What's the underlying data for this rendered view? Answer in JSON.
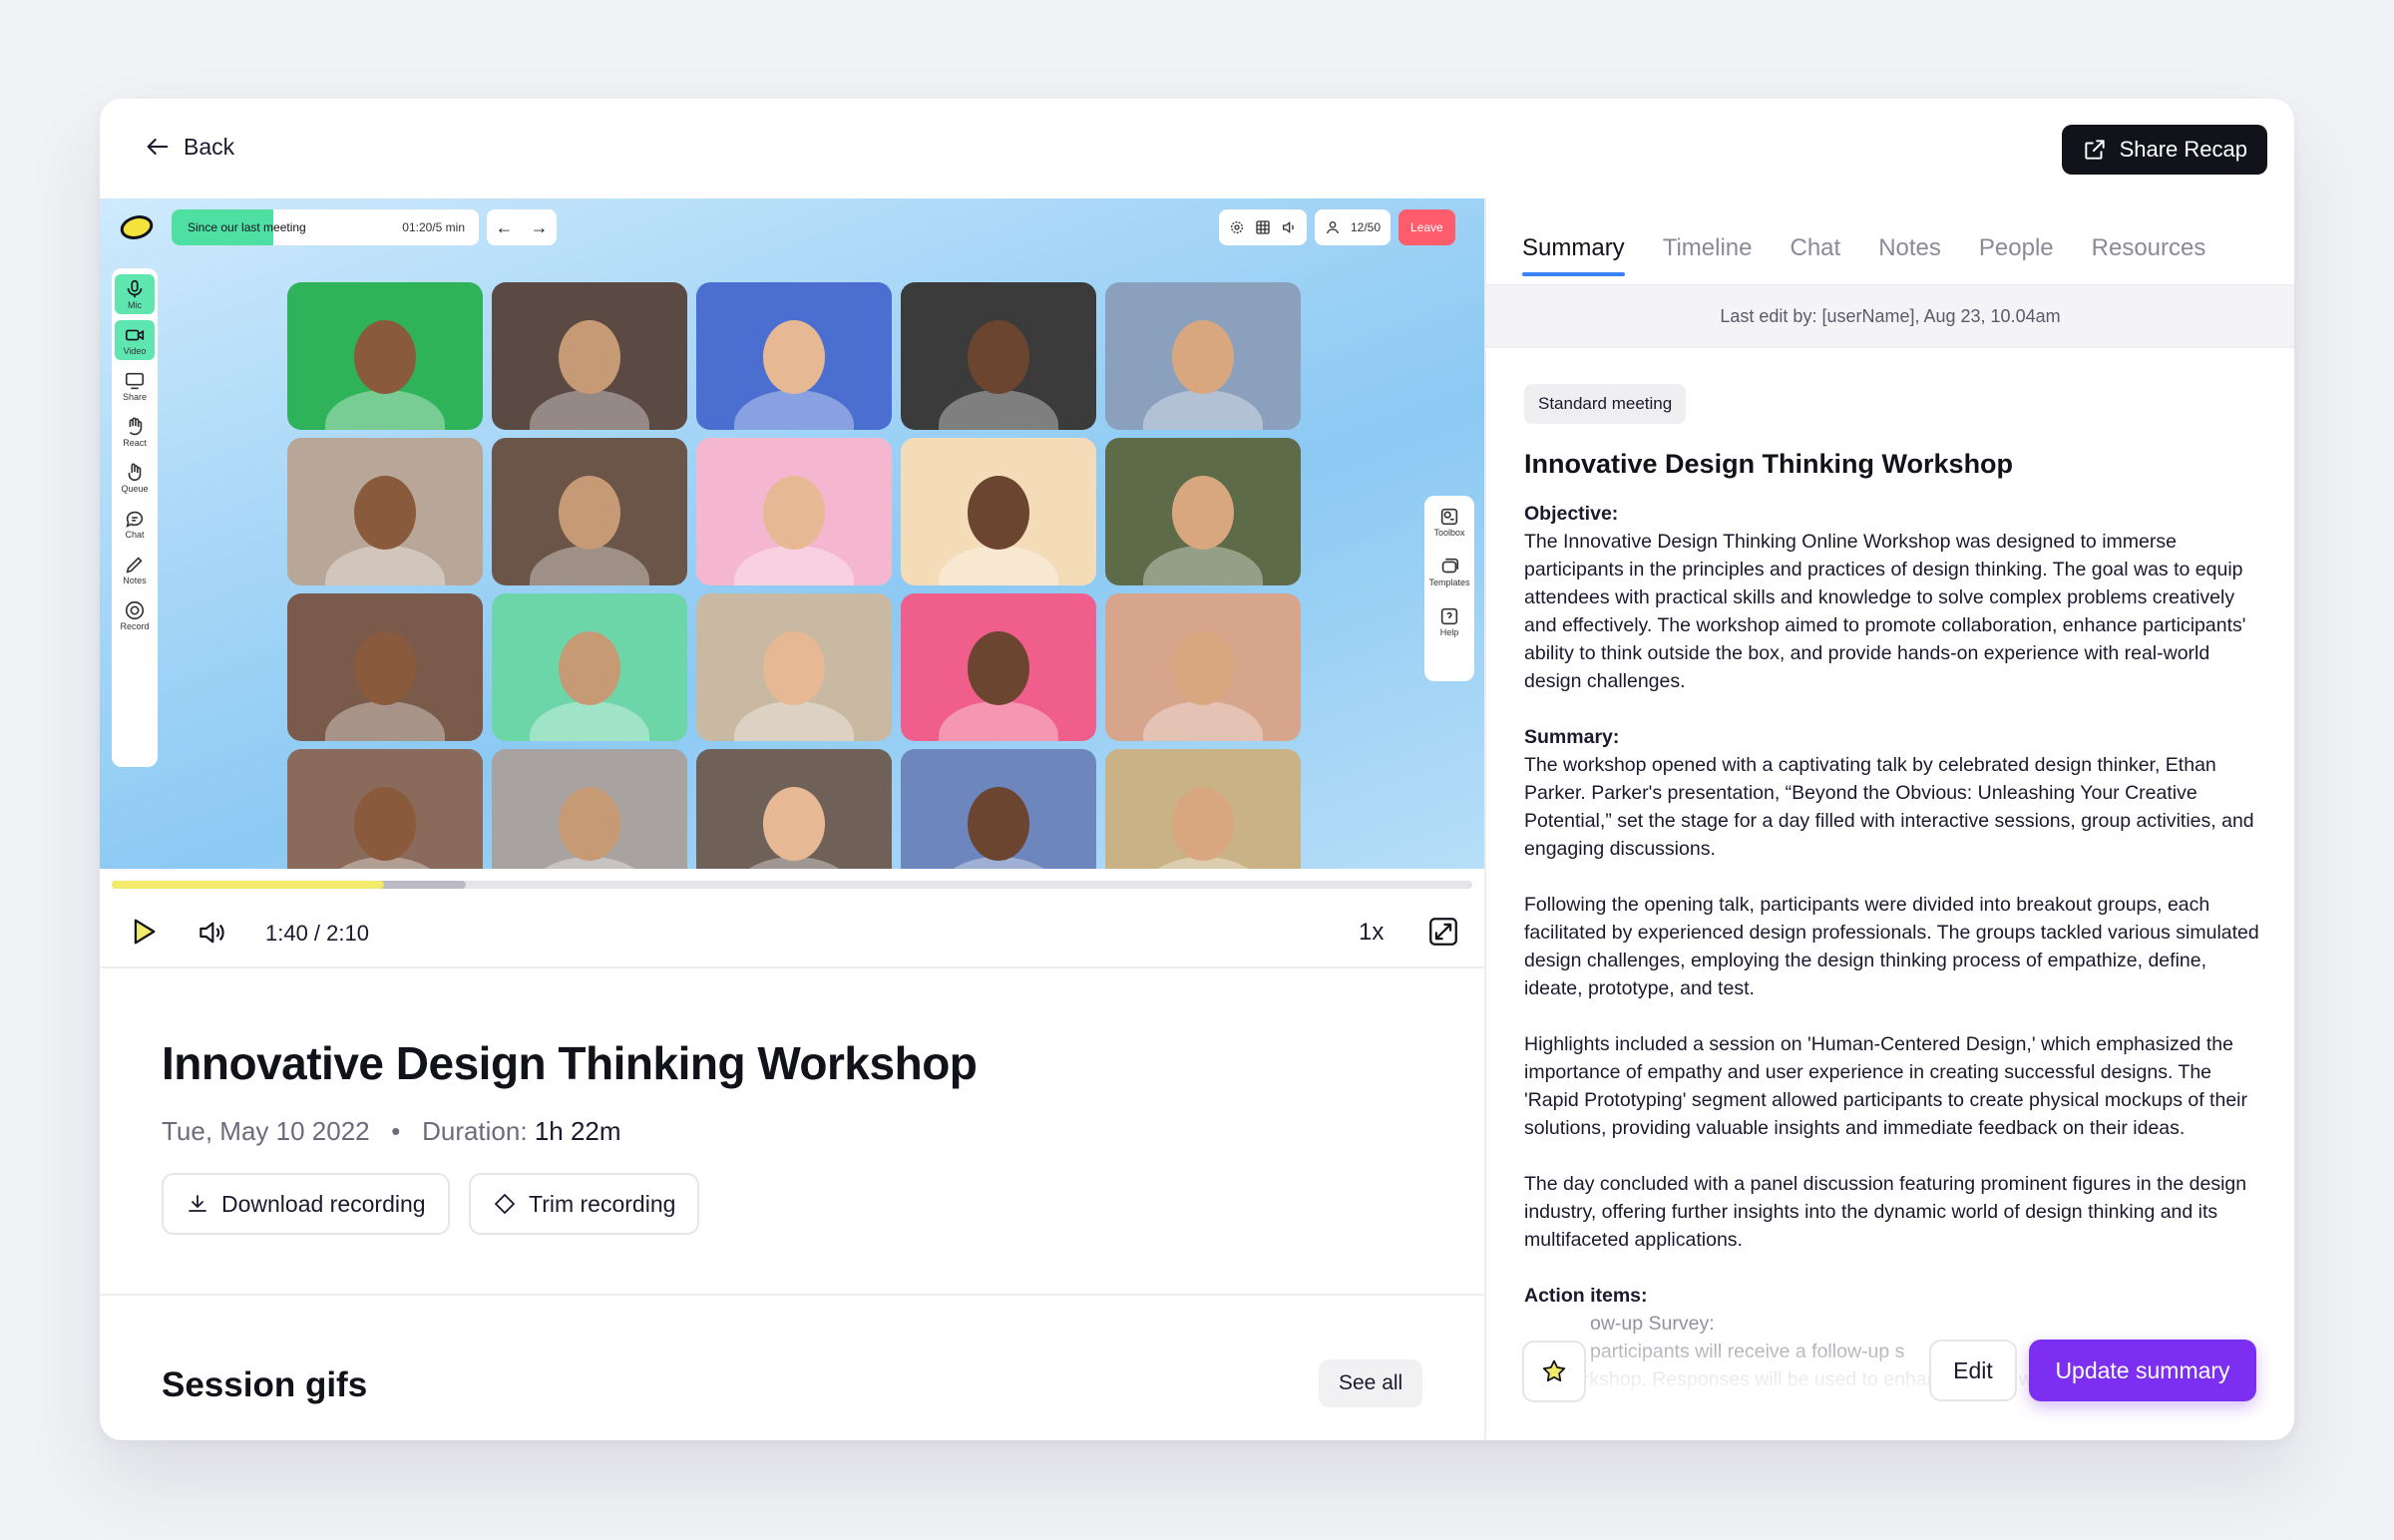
{
  "header": {
    "back_label": "Back",
    "share_label": "Share Recap"
  },
  "video": {
    "since_label": "Since our last meeting",
    "since_time": "01:20/5 min",
    "participants_count": "12/50",
    "leave_label": "Leave",
    "left_tools": [
      "Mic",
      "Video",
      "Share",
      "React",
      "Queue",
      "Chat",
      "Notes",
      "Record"
    ],
    "right_tools": [
      "Toolbox",
      "Templates",
      "Help"
    ],
    "tile_colors": [
      "#2fb35a",
      "#5b4a44",
      "#4a6fd1",
      "#3b3b3b",
      "#8aa0bd",
      "#b8a698",
      "#6a5548",
      "#f4b7cf",
      "#f5dcb8",
      "#5d6b48",
      "#7a5a4a",
      "#6cd6a8",
      "#c9b9a2",
      "#f05f8b",
      "#d7a48c",
      "#8a6a5a",
      "#a8a3a0",
      "#6f6058",
      "#6d86bd",
      "#c9b285"
    ]
  },
  "player": {
    "played_fraction": 0.2,
    "buffered_fraction": 0.26,
    "time_label": "1:40 / 2:10",
    "speed_label": "1x"
  },
  "meeting": {
    "title": "Innovative Design Thinking Workshop",
    "date": "Tue, May 10 2022",
    "duration_label": "Duration:",
    "duration_value": "1h 22m",
    "download_label": "Download recording",
    "trim_label": "Trim recording",
    "gifs_title": "Session gifs",
    "see_all_label": "See all"
  },
  "panel": {
    "tabs": [
      "Summary",
      "Timeline",
      "Chat",
      "Notes",
      "People",
      "Resources"
    ],
    "last_edit": "Last edit by: [userName], Aug 23, 10.04am",
    "tag": "Standard meeting",
    "title": "Innovative Design Thinking Workshop",
    "objective_heading": "Objective:",
    "objective_text": "The Innovative Design Thinking Online Workshop was designed to immerse participants in the principles and practices of design thinking. The goal was to equip attendees with practical skills and knowledge to solve complex problems creatively and effectively. The workshop aimed to promote collaboration, enhance participants' ability to think outside the box, and provide hands-on experience with real-world design challenges.",
    "summary_heading": "Summary:",
    "summary_paragraphs": [
      "The workshop opened with a captivating talk by celebrated design thinker, Ethan Parker. Parker's presentation, “Beyond the Obvious: Unleashing Your Creative Potential,” set the stage for a day filled with interactive sessions, group activities, and engaging discussions.",
      "Following the opening talk, participants were divided into breakout groups, each facilitated by experienced design professionals. The groups tackled various simulated design challenges, employing the design thinking process of empathize, define, ideate, prototype, and test.",
      "Highlights included a session on 'Human-Centered Design,' which emphasized the importance of empathy and user experience in creating successful designs. The 'Rapid Prototyping' segment allowed participants to create physical mockups of their solutions, providing valuable insights and immediate feedback on their ideas.",
      "The day concluded with a panel discussion featuring prominent figures in the design industry, offering further insights into the dynamic world of design thinking and its multifaceted applications."
    ],
    "action_heading": "Action items:",
    "action_line1": "ow-up Survey:",
    "action_line2": "participants will receive a follow-up s",
    "action_line2_tail": "p",
    "action_line3": "workshop. Responses will be used to enhance future workshops.",
    "edit_label": "Edit",
    "update_label": "Update summary"
  }
}
